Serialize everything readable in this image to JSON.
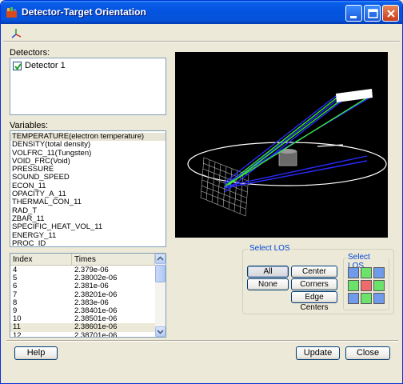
{
  "window": {
    "title": "Detector-Target Orientation"
  },
  "detectors": {
    "label": "Detectors:",
    "items": [
      {
        "label": "Detector 1",
        "checked": true
      }
    ]
  },
  "variables": {
    "label": "Variables:",
    "items": [
      "TEMPERATURE(electron temperature)",
      "DENSITY(total density)",
      "VOLFRC_11(Tungsten)",
      "VOID_FRC(Void)",
      "PRESSURE",
      "SOUND_SPEED",
      "ECON_11",
      "OPACITY_A_11",
      "THERMAL_CON_11",
      "RAD_T",
      "ZBAR_11",
      "SPECIFIC_HEAT_VOL_11",
      "ENERGY_11",
      "PROC_ID"
    ],
    "selected_index": 0
  },
  "times_table": {
    "columns": [
      "Index",
      "Times"
    ],
    "rows": [
      [
        "4",
        "2.379e-06"
      ],
      [
        "5",
        "2.38002e-06"
      ],
      [
        "6",
        "2.381e-06"
      ],
      [
        "7",
        "2.38201e-06"
      ],
      [
        "8",
        "2.383e-06"
      ],
      [
        "9",
        "2.38401e-06"
      ],
      [
        "10",
        "2.38501e-06"
      ],
      [
        "11",
        "2.38601e-06"
      ],
      [
        "12",
        "2.38701e-06"
      ]
    ],
    "selected_index": 7
  },
  "select_los": {
    "title": "Select LOS",
    "buttons": {
      "all": "All",
      "center": "Center",
      "none": "None",
      "corners": "Corners",
      "edge_centers": "Edge Centers"
    },
    "grid_title": "Select LOS",
    "grid_colors": [
      [
        "#6f9bea",
        "#6be36b",
        "#6f9bea"
      ],
      [
        "#6be36b",
        "#ee6b6b",
        "#6be36b"
      ],
      [
        "#6f9bea",
        "#6be36b",
        "#6f9bea"
      ]
    ]
  },
  "footer": {
    "help": "Help",
    "update": "Update",
    "close": "Close"
  },
  "icons": {
    "app": "detector-app-icon",
    "toolbar": "axes-triad-icon",
    "minimize": "minimize-icon",
    "maximize": "maximize-icon",
    "close": "close-icon"
  },
  "colors": {
    "title_bar": "#0554e3",
    "group_title": "#0046d5"
  }
}
